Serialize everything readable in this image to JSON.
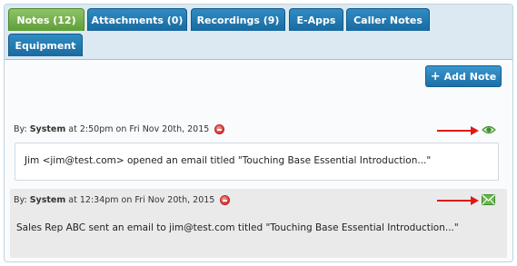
{
  "tabs": [
    {
      "label": "Notes (12)",
      "active": true
    },
    {
      "label": "Attachments (0)",
      "active": false
    },
    {
      "label": "Recordings (9)",
      "active": false
    },
    {
      "label": "E-Apps",
      "active": false
    },
    {
      "label": "Caller Notes",
      "active": false
    },
    {
      "label": "Equipment",
      "active": false
    }
  ],
  "toolbar": {
    "add_note_label": "Add Note"
  },
  "notes": [
    {
      "by_prefix": "By:",
      "author": "System",
      "meta": "at 2:50pm on Fri Nov 20th, 2015",
      "type_icon": "eye-icon",
      "body": "Jim <jim@test.com> opened an email titled \"Touching Base Essential Introduction...\""
    },
    {
      "by_prefix": "By:",
      "author": "System",
      "meta": "at 12:34pm on Fri Nov 20th, 2015",
      "type_icon": "envelope-icon",
      "body": "Sales Rep ABC sent an email to jim@test.com titled \"Touching Base Essential Introduction...\""
    }
  ],
  "colors": {
    "tab_active": "#6aab43",
    "tab_inactive": "#1f79b3",
    "annotation_arrow": "#e01818",
    "delete_icon": "#d33a3a",
    "status_icon": "#4a9a3a"
  }
}
